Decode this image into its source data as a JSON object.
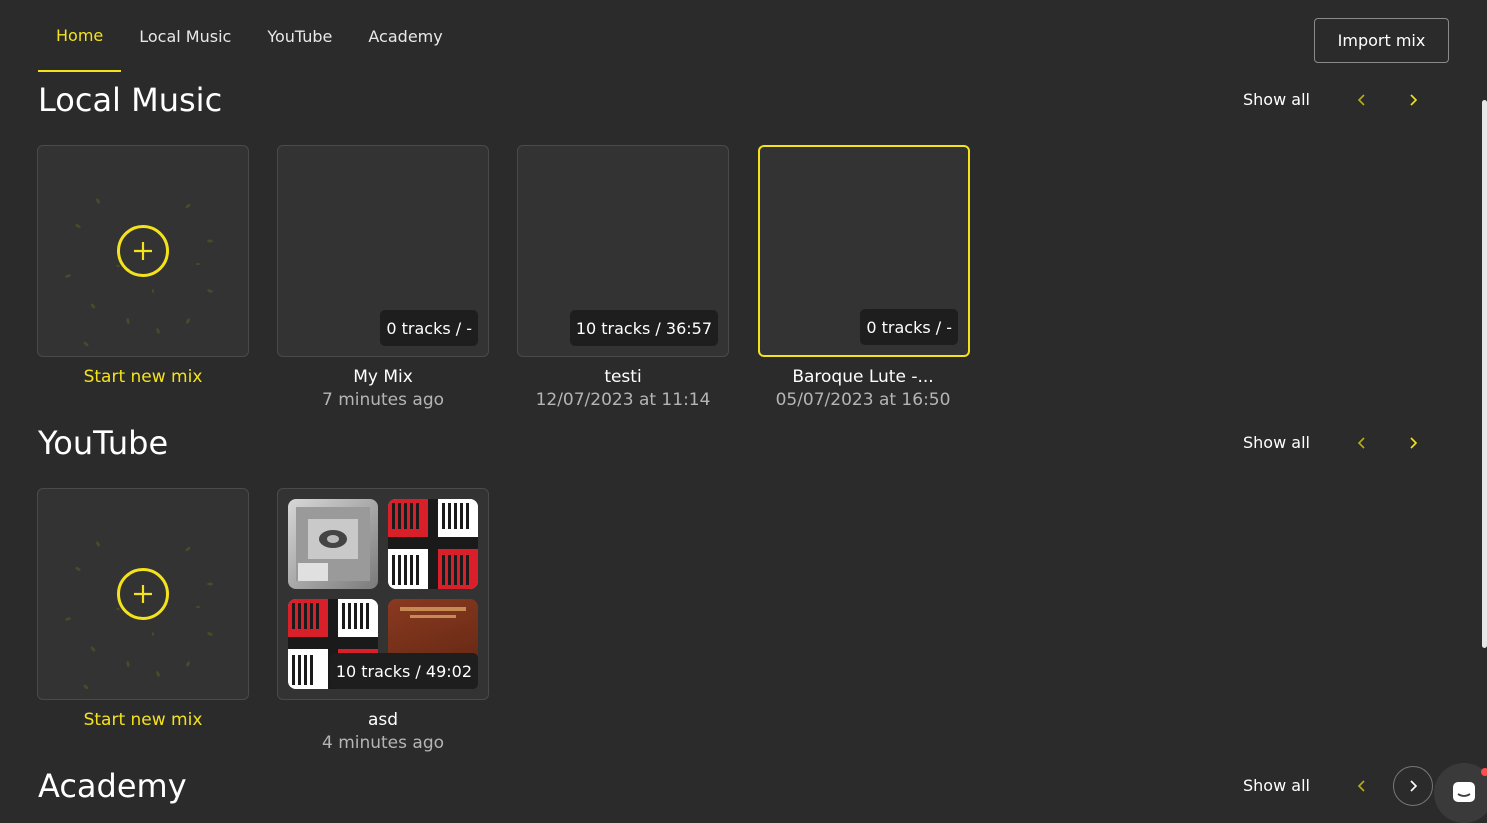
{
  "nav": {
    "tabs": [
      {
        "label": "Home"
      },
      {
        "label": "Local Music"
      },
      {
        "label": "YouTube"
      },
      {
        "label": "Academy"
      }
    ],
    "import_label": "Import mix"
  },
  "sections": {
    "local": {
      "title": "Local Music",
      "show_all": "Show all",
      "new_mix_label": "Start new mix",
      "mixes": [
        {
          "name": "My Mix",
          "time": "7 minutes ago",
          "badge": "0 tracks / -"
        },
        {
          "name": "testi",
          "time": "12/07/2023 at 11:14",
          "badge": "10 tracks / 36:57"
        },
        {
          "name": "Baroque Lute -...",
          "time": "05/07/2023 at 16:50",
          "badge": "0 tracks / -"
        }
      ]
    },
    "youtube": {
      "title": "YouTube",
      "show_all": "Show all",
      "new_mix_label": "Start new mix",
      "mixes": [
        {
          "name": "asd",
          "time": "4 minutes ago",
          "badge": "10 tracks / 49:02"
        }
      ]
    },
    "academy": {
      "title": "Academy",
      "show_all": "Show all"
    }
  },
  "colors": {
    "accent": "#f4e31c",
    "background": "#2b2b2b",
    "card": "#333333"
  },
  "icons": [
    "plus-icon",
    "chevron-left-icon",
    "chevron-right-icon",
    "chat-icon"
  ]
}
